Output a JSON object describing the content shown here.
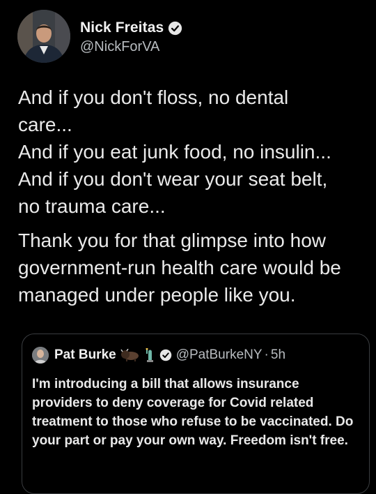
{
  "author": {
    "name": "Nick Freitas",
    "handle": "@NickForVA",
    "avatar_icon": "profile-photo",
    "verified_icon": "verified-badge-icon"
  },
  "tweet": {
    "paragraph1": "And if you don't floss, no dental care...\nAnd if you eat junk food, no insulin...\nAnd if you don't wear your seat belt, no trauma care...",
    "paragraph2": "Thank you for that glimpse into how government-run health care would be managed under people like you."
  },
  "quoted_tweet": {
    "author_name": "Pat Burke",
    "emoji_icons": [
      "bison-emoji",
      "statue-of-liberty-emoji"
    ],
    "handle": "@PatBurkeNY",
    "separator": "·",
    "time": "5h",
    "text": "I'm introducing a bill that allows insurance providers to deny coverage for Covid related treatment to those who refuse to be vaccinated. Do your part or pay your own way. Freedom isn't free."
  },
  "colors": {
    "background": "#000000",
    "text": "#e7e9ea",
    "secondary_text": "#b8bcc0",
    "border": "#3a3d40"
  }
}
